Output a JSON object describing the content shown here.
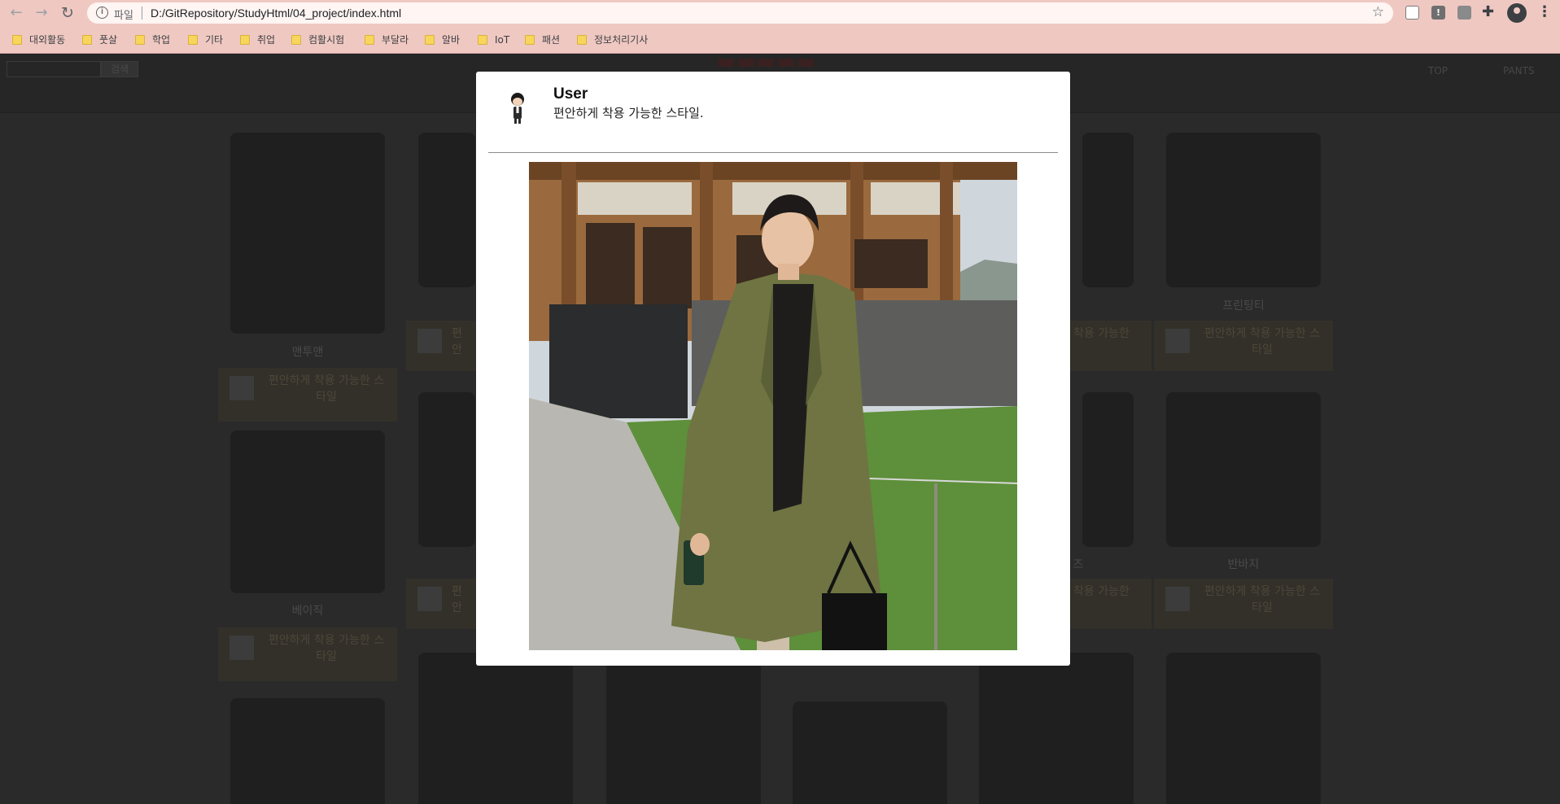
{
  "browser": {
    "scheme_label": "파일",
    "url": "D:/GitRepository/StudyHtml/04_project/index.html",
    "bookmarks": [
      "대외활동",
      "풋살",
      "학업",
      "기타",
      "취업",
      "컴활시험",
      "부달라",
      "알바",
      "IoT",
      "패션",
      "정보처리기사"
    ]
  },
  "page": {
    "search_button": "검색",
    "menu": [
      "TOP",
      "PANTS"
    ],
    "cards": [
      {
        "name": "맨투맨",
        "desc": "편안하게 착용 가능한 스타일"
      },
      {
        "name": "프린팅티",
        "desc": "편안하게 착용 가능한 스타일"
      },
      {
        "name": "베이직",
        "desc": "편안하게 착용 가능한 스타일"
      },
      {
        "name": "반바지",
        "desc": "편안하게 착용 가능한 스타일"
      },
      {
        "name": "",
        "desc": "편안"
      },
      {
        "name": "",
        "desc": "편안"
      },
      {
        "name": "",
        "desc": "착용 가능한"
      },
      {
        "name": "즈",
        "desc": "착용 가능한"
      }
    ]
  },
  "modal": {
    "user": "User",
    "caption": "편안하게 착용 가능한 스타일."
  },
  "colors": {
    "browser_chrome": "#f0c8c2",
    "overlay_page": "#2a2a2a",
    "modal_bg": "#ffffff",
    "coat": "#6f7442"
  }
}
